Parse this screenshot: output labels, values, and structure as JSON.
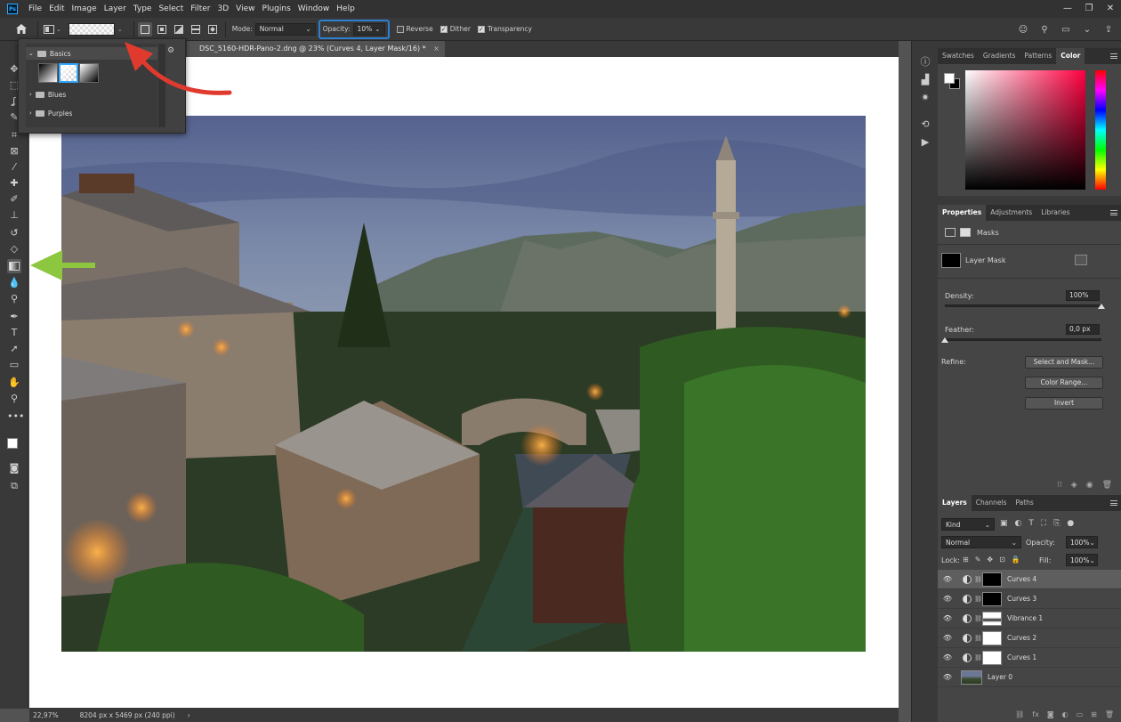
{
  "app": {
    "logo": "Ps",
    "menus": [
      "File",
      "Edit",
      "Image",
      "Layer",
      "Type",
      "Select",
      "Filter",
      "3D",
      "View",
      "Plugins",
      "Window",
      "Help"
    ],
    "window_controls": [
      "—",
      "❐",
      "✕"
    ]
  },
  "options_bar": {
    "mode_label": "Mode:",
    "mode_value": "Normal",
    "opacity_label": "Opacity:",
    "opacity_value": "10%",
    "reverse_label": "Reverse",
    "reverse_checked": false,
    "dither_label": "Dither",
    "dither_checked": true,
    "transparency_label": "Transparency",
    "transparency_checked": true,
    "highlight_color": "#2d7fd1"
  },
  "gradient_picker": {
    "basics_label": "Basics",
    "blues_label": "Blues",
    "purples_label": "Purples"
  },
  "document": {
    "tab_title": "DSC_5160-HDR-Pano-2.dng @ 23% (Curves 4, Layer Mask/16) *",
    "tab_close": "×"
  },
  "status_bar": {
    "zoom": "22,97%",
    "dimensions": "8204 px x 5469 px (240 ppi)",
    "arrow": "›"
  },
  "color_panel": {
    "tabs": [
      "Swatches",
      "Gradients",
      "Patterns",
      "Color"
    ],
    "active_tab": "Color"
  },
  "properties_panel": {
    "tabs": [
      "Properties",
      "Adjustments",
      "Libraries"
    ],
    "active_tab": "Properties",
    "section_label": "Masks",
    "layer_mask_label": "Layer Mask",
    "density_label": "Density:",
    "density_value": "100%",
    "density_fraction": 1.0,
    "feather_label": "Feather:",
    "feather_value": "0,0 px",
    "feather_fraction": 0.0,
    "refine_label": "Refine:",
    "select_and_mask": "Select and Mask...",
    "color_range": "Color Range...",
    "invert": "Invert"
  },
  "layers_panel": {
    "tabs": [
      "Layers",
      "Channels",
      "Paths"
    ],
    "active_tab": "Layers",
    "kind_label": "Kind",
    "blend_mode": "Normal",
    "opacity_label": "Opacity:",
    "opacity_value": "100%",
    "lock_label": "Lock:",
    "fill_label": "Fill:",
    "fill_value": "100%",
    "layers": [
      {
        "name": "Curves 4",
        "selected": true,
        "mask": "dark"
      },
      {
        "name": "Curves 3",
        "selected": false,
        "mask": "dark"
      },
      {
        "name": "Vibrance 1",
        "selected": false,
        "mask": "mixed"
      },
      {
        "name": "Curves 2",
        "selected": false,
        "mask": "white"
      },
      {
        "name": "Curves 1",
        "selected": false,
        "mask": "white"
      },
      {
        "name": "Layer 0",
        "selected": false,
        "mask": "photo"
      }
    ]
  },
  "annotations": {
    "red_arrow_color": "#e03a2f",
    "green_arrow_color": "#8dc63f"
  }
}
